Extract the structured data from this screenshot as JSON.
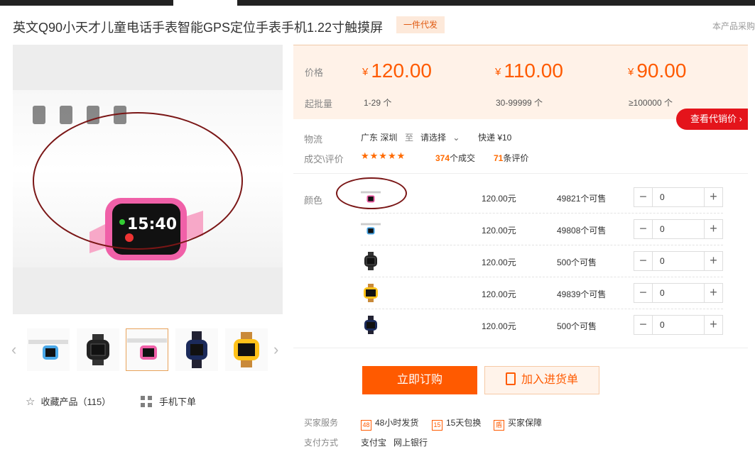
{
  "product": {
    "title": "英文Q90小天才儿童电话手表智能GPS定位手表手机1.22寸触摸屏",
    "tag": "一件代发",
    "side_note": "本产品采购"
  },
  "gallery": {
    "main_watch_time": "15:40",
    "thumbs": [
      "blue-white-watch",
      "black-watch",
      "pink-watch",
      "navy-watch",
      "orange-watch"
    ],
    "selected_thumb": 2
  },
  "actions": {
    "favorite": "收藏产品（115）",
    "mobile_order": "手机下单"
  },
  "pricing": {
    "price_label": "价格",
    "qty_label": "起批量",
    "currency": "¥",
    "tiers": [
      {
        "price": "120.00",
        "qty": "1-29 个"
      },
      {
        "price": "110.00",
        "qty": "30-99999 个"
      },
      {
        "price": "90.00",
        "qty": "≥100000 个"
      }
    ],
    "agent_button": "查看代销价"
  },
  "logistics": {
    "label": "物流",
    "from": "广东 深圳",
    "to_word": "至",
    "select": "请选择",
    "express": "快递 ¥10"
  },
  "deals": {
    "label": "成交\\评价",
    "stars": "★★★★★",
    "rating": 4.5,
    "deal_count": "374",
    "deal_suffix": "个成交",
    "review_count": "71",
    "review_suffix": "条评价"
  },
  "variants": {
    "label": "颜色",
    "items": [
      {
        "thumb": "pink-watch",
        "price": "120.00元",
        "stock": "49821个可售",
        "qty": "0"
      },
      {
        "thumb": "blue-white-watch",
        "price": "120.00元",
        "stock": "49808个可售",
        "qty": "0"
      },
      {
        "thumb": "black-watch",
        "price": "120.00元",
        "stock": "500个可售",
        "qty": "0"
      },
      {
        "thumb": "orange-watch",
        "price": "120.00元",
        "stock": "49839个可售",
        "qty": "0"
      },
      {
        "thumb": "navy-watch",
        "price": "120.00元",
        "stock": "500个可售",
        "qty": "0"
      }
    ]
  },
  "buttons": {
    "buy": "立即订购",
    "cart": "加入进货单"
  },
  "services": {
    "label": "买家服务",
    "items": [
      {
        "icon": "48",
        "text": "48小时发货"
      },
      {
        "icon": "15",
        "text": "15天包换"
      },
      {
        "icon": "盾",
        "text": "买家保障"
      }
    ]
  },
  "payment": {
    "label": "支付方式",
    "methods": [
      "支付宝",
      "网上银行"
    ]
  },
  "colors": {
    "accent": "#ff5a00",
    "agent_red": "#e4141b",
    "highlight_ring": "#7a1616"
  }
}
